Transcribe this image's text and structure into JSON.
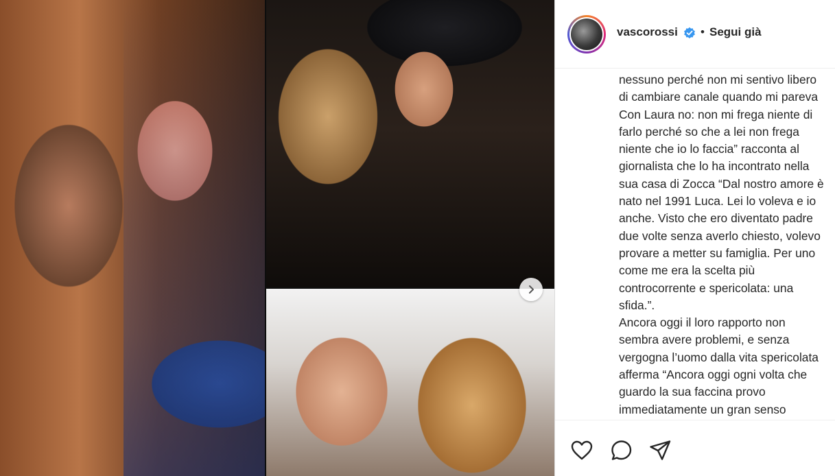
{
  "post": {
    "username": "vascorossi",
    "verified": true,
    "separator": "•",
    "follow_label": "Segui già",
    "caption_lines": [
      "nessuno perché non mi sentivo libero",
      "di cambiare canale quando mi pareva",
      "Con Laura no: non mi frega niente di",
      "farlo perché so che a lei non frega",
      "niente che io lo faccia” racconta al",
      "giornalista che lo ha incontrato nella",
      "sua casa di Zocca “Dal nostro amore è",
      "nato nel 1991 Luca. Lei lo voleva e io",
      "anche. Visto che ero diventato padre",
      "due volte senza averlo chiesto, volevo",
      "provare a metter su famiglia. Per uno",
      "come me era la scelta più",
      "controcorrente e spericolata: una",
      "sfida.”.",
      "Ancora oggi il loro rapporto non",
      "sembra avere problemi, e senza",
      "vergogna l’uomo dalla vita spericolata",
      "afferma “Ancora oggi ogni volta che",
      "guardo la sua faccina provo",
      "immediatamente un gran senso"
    ]
  },
  "icons": {
    "verified": "verified-badge-icon",
    "next": "chevron-right-icon",
    "like": "heart-icon",
    "comment": "comment-bubble-icon",
    "share": "paper-plane-icon"
  },
  "colors": {
    "text": "#262626",
    "verified_blue": "#3897f0",
    "border": "#dbdbdb"
  }
}
